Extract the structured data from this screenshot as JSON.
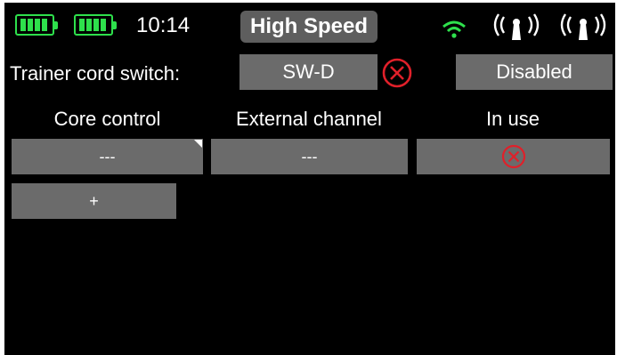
{
  "status_bar": {
    "battery_icons": [
      "battery-icon",
      "battery-icon"
    ],
    "time": "10:14",
    "mode": "High Speed",
    "wifi_icon": "wifi-icon",
    "antenna_icons": [
      "antenna-icon",
      "antenna-icon"
    ],
    "accent_green": "#2ee04c"
  },
  "trainer": {
    "label": "Trainer cord switch:",
    "switch_value": "SW-D",
    "clear_icon": "x-circle-icon",
    "status": "Disabled"
  },
  "table": {
    "headers": [
      "Core control",
      "External channel",
      "In use"
    ],
    "rows": [
      {
        "core_control": "---",
        "external_channel": "---",
        "in_use_icon": "x-circle-icon"
      }
    ]
  },
  "add_button": "+",
  "colors": {
    "button": "#6b6b6b",
    "error_red": "#e0202a",
    "background": "#000000"
  }
}
